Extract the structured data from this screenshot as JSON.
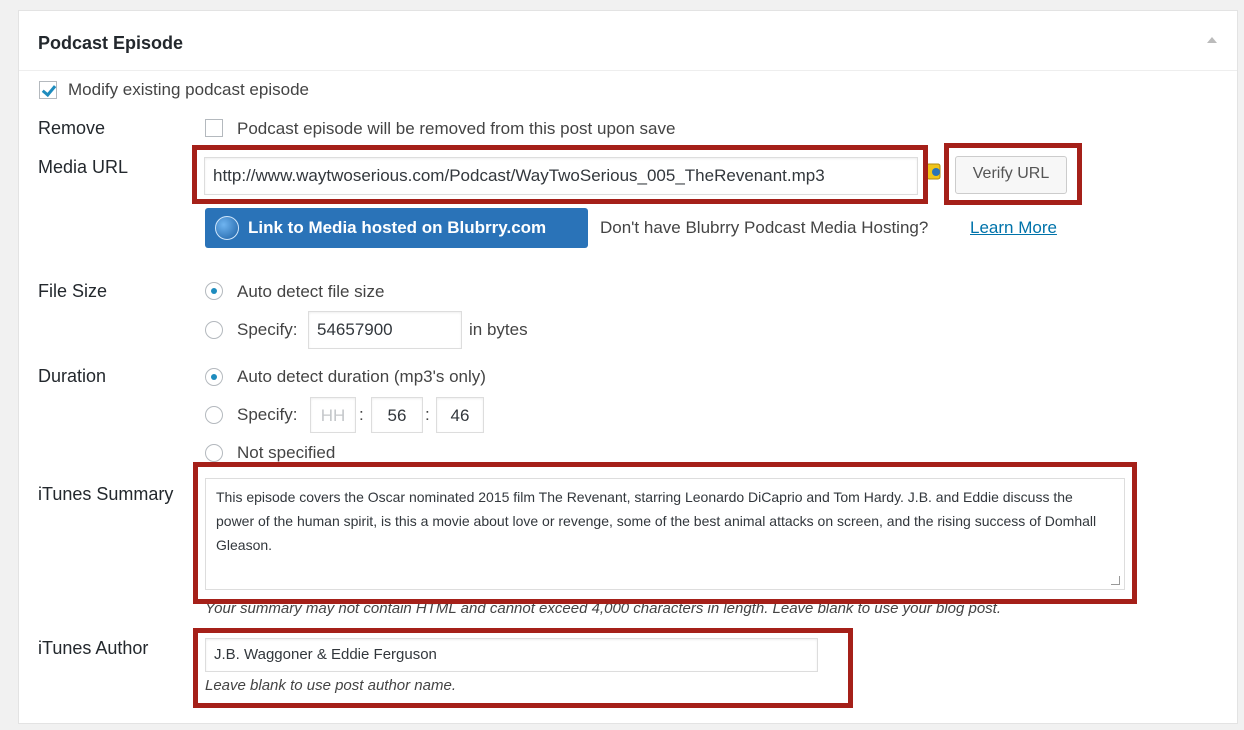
{
  "panel": {
    "title": "Podcast Episode"
  },
  "modify": {
    "label": "Modify existing podcast episode",
    "checked": true
  },
  "remove": {
    "label": "Remove",
    "option": "Podcast episode will be removed from this post upon save"
  },
  "media_url": {
    "label": "Media URL",
    "value": "http://www.waytwoserious.com/Podcast/WayTwoSerious_005_TheRevenant.mp3",
    "verify_button": "Verify URL",
    "blubrry_button": "Link to Media hosted on Blubrry.com",
    "hosting_text": "Don't have Blubrry Podcast Media Hosting?",
    "learn_more": "Learn More"
  },
  "file_size": {
    "label": "File Size",
    "auto": "Auto detect file size",
    "specify": "Specify:",
    "value": "54657900",
    "unit": "in bytes"
  },
  "duration": {
    "label": "Duration",
    "auto": "Auto detect duration (mp3's only)",
    "specify": "Specify:",
    "hh": "HH",
    "mm": "56",
    "ss": "46",
    "sep": ":",
    "not_specified": "Not specified"
  },
  "itunes_summary": {
    "label": "iTunes Summary",
    "value": "This episode covers the Oscar nominated 2015 film The Revenant, starring Leonardo DiCaprio and Tom Hardy. J.B. and Eddie discuss the power of the human spirit, is this a movie about love or revenge, some of the best animal attacks on screen, and the rising success of Domhall Gleason.",
    "help": "Your summary may not contain HTML and cannot exceed 4,000 characters in length. Leave blank to use your blog post."
  },
  "itunes_author": {
    "label": "iTunes Author",
    "value": "J.B. Waggoner & Eddie Ferguson",
    "help": "Leave blank to use post author name."
  },
  "colors": {
    "accent": "#1e8cbe",
    "highlight": "#a52019",
    "button_blue": "#2a73b8"
  }
}
